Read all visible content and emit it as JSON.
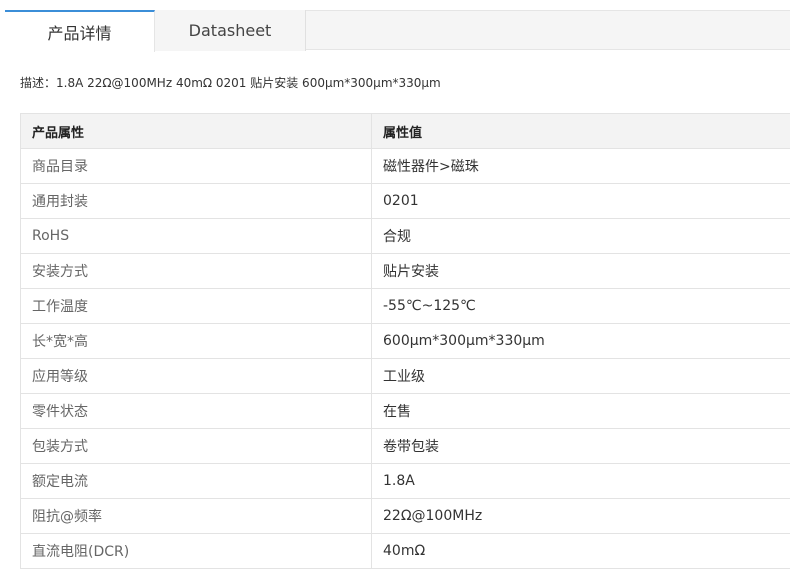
{
  "tabs": [
    {
      "label": "产品详情",
      "active": true
    },
    {
      "label": "Datasheet",
      "active": false
    }
  ],
  "description": "描述：1.8A 22Ω@100MHz 40mΩ 0201 贴片安装 600μm*300μm*330μm",
  "table": {
    "headers": [
      "产品属性",
      "属性值"
    ],
    "rows": [
      {
        "name": "商品目录",
        "value": "磁性器件>磁珠"
      },
      {
        "name": "通用封装",
        "value": "0201"
      },
      {
        "name": "RoHS",
        "value": "合规"
      },
      {
        "name": "安装方式",
        "value": "贴片安装"
      },
      {
        "name": "工作温度",
        "value": "-55℃~125℃"
      },
      {
        "name": "长*宽*高",
        "value": "600μm*300μm*330μm"
      },
      {
        "name": "应用等级",
        "value": "工业级"
      },
      {
        "name": "零件状态",
        "value": "在售"
      },
      {
        "name": "包装方式",
        "value": "卷带包装"
      },
      {
        "name": "额定电流",
        "value": "1.8A"
      },
      {
        "name": "阻抗@频率",
        "value": "22Ω@100MHz"
      },
      {
        "name": "直流电阻(DCR)",
        "value": "40mΩ"
      }
    ]
  },
  "colors": {
    "active_tab_accent": "#3b8ed8",
    "header_bg": "#f3f3f3",
    "border": "#e3e3e3"
  }
}
